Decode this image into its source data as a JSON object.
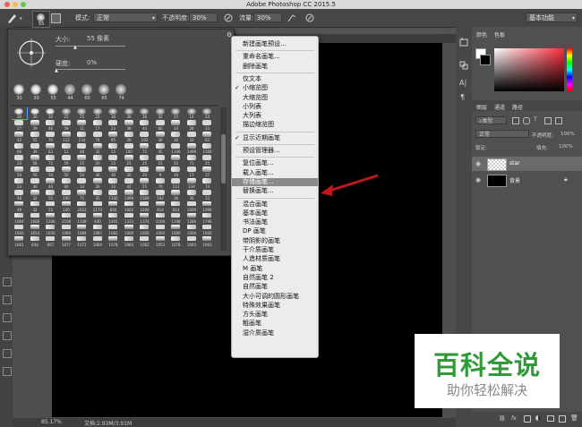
{
  "window": {
    "title": "Adobe Photoshop CC 2015.5"
  },
  "options_bar": {
    "size_value": "55",
    "mode_label": "模式:",
    "mode_value": "正常",
    "opacity_label": "不透明度:",
    "opacity_value": "30%",
    "flow_label": "流量:",
    "flow_value": "30%",
    "workspace_value": "基本功能"
  },
  "brush_panel": {
    "size_label": "大小:",
    "size_value": "55 像素",
    "hardness_label": "硬度:",
    "hardness_value": "0%",
    "preview_numbers": [
      "30",
      "30",
      "55",
      "44",
      "60",
      "65",
      "74"
    ],
    "grid_numbers": [
      [
        "30",
        "30",
        "30",
        "25",
        "25",
        "25",
        "36",
        "36",
        "36",
        "32",
        "25",
        "14",
        "24"
      ],
      [
        "27",
        "39",
        "46",
        "59",
        "11",
        "17",
        "23",
        "36",
        "44",
        "60",
        "14",
        "26",
        "33"
      ],
      [
        "42",
        "55",
        "70",
        "112",
        "134",
        "74",
        "95",
        "29",
        "192",
        "36",
        "36",
        "33",
        "63"
      ],
      [
        "66",
        "39",
        "63",
        "11",
        "48",
        "32",
        "55",
        "100",
        "75",
        "45",
        "1106",
        "1499",
        "1569"
      ],
      [
        "23",
        "58",
        "75",
        "59",
        "25",
        "20",
        "25",
        "25",
        "25",
        "25",
        "50",
        "71",
        "25"
      ],
      [
        "50",
        "50",
        "50",
        "50",
        "50",
        "36",
        "30",
        "30",
        "20",
        "9",
        "30",
        "17",
        "17"
      ],
      [
        "23",
        "36",
        "44",
        "60",
        "14",
        "26",
        "33",
        "42",
        "55",
        "70",
        "112",
        "134",
        "74"
      ],
      [
        "48",
        "32",
        "55",
        "100",
        "75",
        "45",
        "1106",
        "1499",
        "1569",
        "192",
        "36",
        "36",
        "33"
      ],
      [
        "49",
        "32",
        "55",
        "100",
        "2023",
        "2173",
        "800",
        "1002",
        "1000",
        "814",
        "814",
        "1000",
        "1099"
      ],
      [
        "1064",
        "1608",
        "1206",
        "1108",
        "1108",
        "440",
        "1401",
        "1333",
        "1374",
        "1100",
        "1108",
        "1286",
        "1796"
      ],
      [
        "1660",
        "1654",
        "1656",
        "1090",
        "1084",
        "1087",
        "1082",
        "1000",
        "1000",
        "1000",
        "1000",
        "1000",
        "1000"
      ],
      [
        "1661",
        "834",
        "667",
        "1077",
        "1071",
        "1064",
        "1078",
        "1064",
        "1062",
        "1053",
        "1078",
        "1063",
        "1063"
      ]
    ]
  },
  "menu": {
    "items": [
      {
        "label": "新建画笔预设...",
        "checked": false
      },
      {
        "label": "重命名画笔...",
        "checked": false
      },
      {
        "label": "删除画笔",
        "checked": false
      },
      {
        "label": "仅文本",
        "checked": false
      },
      {
        "label": "小缩览图",
        "checked": true
      },
      {
        "label": "大缩览图",
        "checked": false
      },
      {
        "label": "小列表",
        "checked": false
      },
      {
        "label": "大列表",
        "checked": false
      },
      {
        "label": "描边缩览图",
        "checked": false
      },
      {
        "label": "显示近期画笔",
        "checked": true
      },
      {
        "label": "预设管理器...",
        "checked": false
      },
      {
        "label": "复位画笔...",
        "checked": false
      },
      {
        "label": "载入画笔...",
        "checked": false
      },
      {
        "label": "存储画笔...",
        "checked": false,
        "highlighted": true
      },
      {
        "label": "替换画笔...",
        "checked": false
      },
      {
        "label": "混合画笔",
        "checked": false
      },
      {
        "label": "基本画笔",
        "checked": false
      },
      {
        "label": "书法画笔",
        "checked": false
      },
      {
        "label": "DP 画笔",
        "checked": false
      },
      {
        "label": "带阴影的画笔",
        "checked": false
      },
      {
        "label": "干介质画笔",
        "checked": false
      },
      {
        "label": "人造材质画笔",
        "checked": false
      },
      {
        "label": "M 画笔",
        "checked": false
      },
      {
        "label": "自然画笔 2",
        "checked": false
      },
      {
        "label": "自然画笔",
        "checked": false
      },
      {
        "label": "大小可调的圆形画笔",
        "checked": false
      },
      {
        "label": "特殊效果画笔",
        "checked": false
      },
      {
        "label": "方头画笔",
        "checked": false
      },
      {
        "label": "粗画笔",
        "checked": false
      },
      {
        "label": "湿介质画笔",
        "checked": false
      }
    ]
  },
  "right_panels": {
    "color_tab": "颜色",
    "swatches_tab": "色板",
    "layers_tab": "图层",
    "channels_tab": "通道",
    "paths_tab": "路径",
    "filter_kind": "类型",
    "blend_mode": "正常",
    "opacity_label": "不透明度:",
    "opacity_value": "100%",
    "lock_label": "锁定:",
    "fill_label": "填充:",
    "fill_value": "100%",
    "layers": [
      {
        "name": "star"
      },
      {
        "name": "背景"
      }
    ]
  },
  "status_bar": {
    "zoom": "85.17%",
    "doc_info": "文档:2.93M/3.91M"
  },
  "watermark": {
    "title": "百科全说",
    "subtitle": "助你轻松解决"
  },
  "colors": {
    "accent_arrow": "#c0161b",
    "watermark_green": "#2f9a37"
  }
}
